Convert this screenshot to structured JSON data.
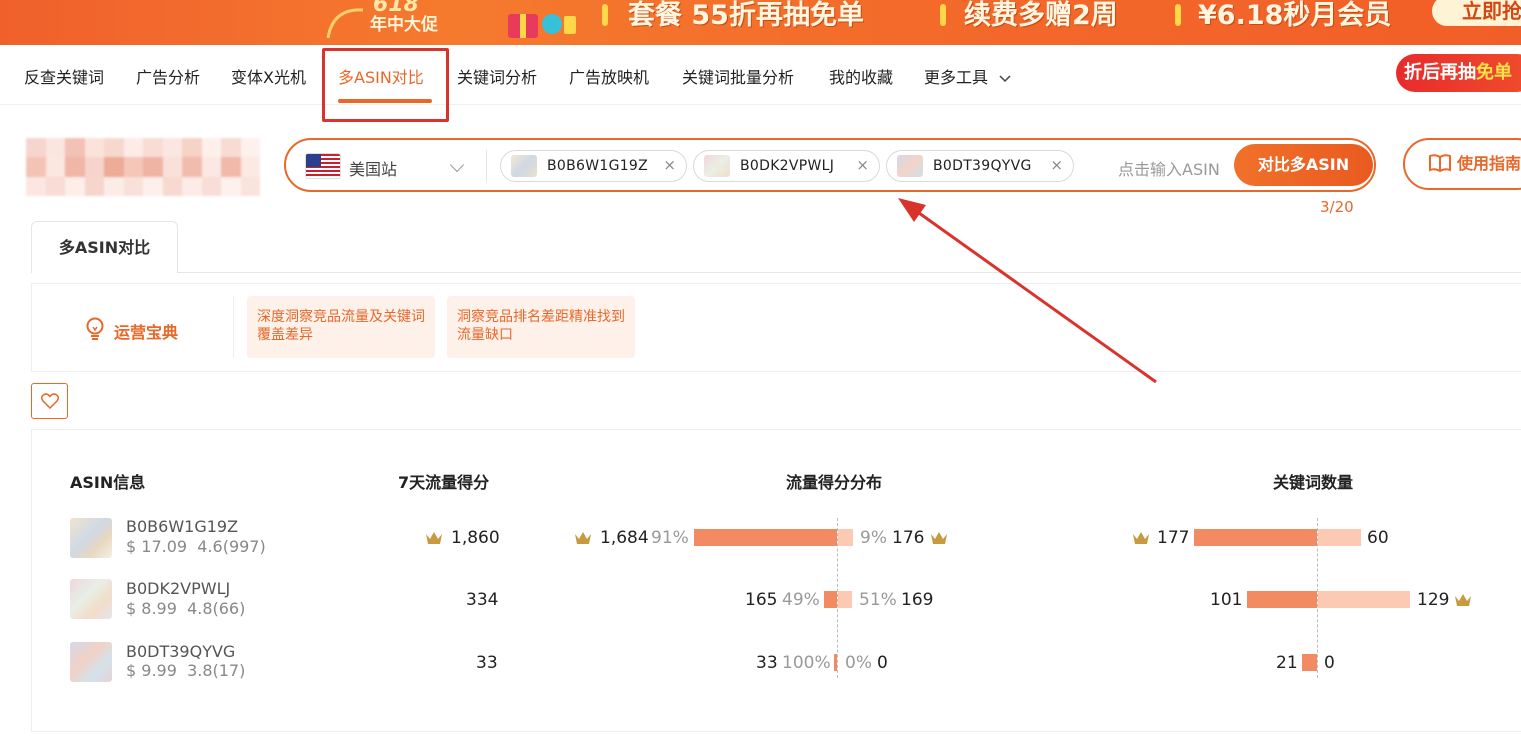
{
  "banner": {
    "year": "618",
    "sub": "年中大促",
    "promo1": "套餐 55折再抽免单",
    "promo2": "续费多赠2周",
    "promo3": "¥6.18秒月会员",
    "cta": "立即抢"
  },
  "nav": {
    "items": [
      "反查关键词",
      "广告分析",
      "变体X光机",
      "多ASIN对比",
      "关键词分析",
      "广告放映机",
      "关键词批量分析",
      "我的收藏",
      "更多工具"
    ],
    "promo_pill_a": "折后再抽",
    "promo_pill_b": "免单"
  },
  "search": {
    "station": "美国站",
    "chips": [
      "B0B6W1G19Z",
      "B0DK2VPWLJ",
      "B0DT39QYVG"
    ],
    "placeholder": "点击输入ASIN",
    "button": "对比多ASIN",
    "counter": "3/20",
    "guide": "使用指南"
  },
  "tab": {
    "label": "多ASIN对比"
  },
  "ops": {
    "title": "运营宝典",
    "card1": "深度洞察竞品流量及关键词覆盖差异",
    "card2": "洞察竞品排名差距精准找到流量缺口"
  },
  "table": {
    "headers": {
      "asin": "ASIN信息",
      "score": "7天流量得分",
      "dist": "流量得分分布",
      "kw": "关键词数量"
    },
    "rows": [
      {
        "asin": "B0B6W1G19Z",
        "price": "$ 17.09",
        "rating": "4.6(997)",
        "score": "1,860",
        "dist_left": "1,684",
        "dist_left_pct": "91%",
        "dist_right_pct": "9%",
        "dist_right": "176",
        "kw_left": "177",
        "kw_right": "60"
      },
      {
        "asin": "B0DK2VPWLJ",
        "price": "$ 8.99",
        "rating": "4.8(66)",
        "score": "334",
        "dist_left": "165",
        "dist_left_pct": "49%",
        "dist_right_pct": "51%",
        "dist_right": "169",
        "kw_left": "101",
        "kw_right": "129"
      },
      {
        "asin": "B0DT39QYVG",
        "price": "$ 9.99",
        "rating": "3.8(17)",
        "score": "33",
        "dist_left": "33",
        "dist_left_pct": "100%",
        "dist_right_pct": "0%",
        "dist_right": "0",
        "kw_left": "21",
        "kw_right": "0"
      }
    ]
  },
  "colors": {
    "accent": "#e8682a",
    "bar_dark": "#f28a62",
    "bar_light": "#fcc9b2",
    "annotation_red": "#d9342b"
  }
}
